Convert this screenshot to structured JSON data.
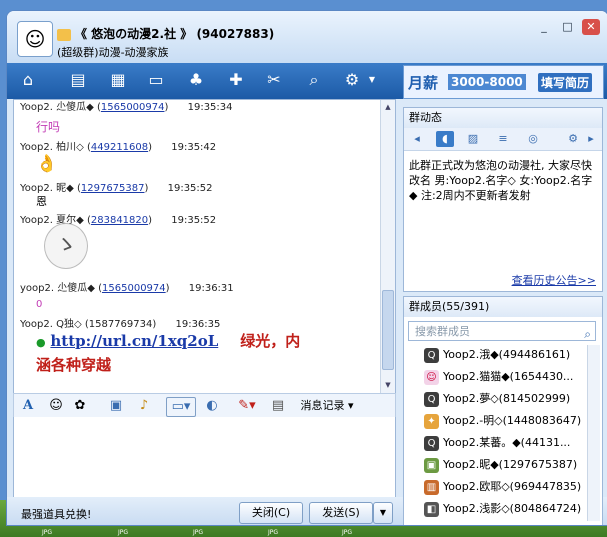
{
  "window": {
    "title": "《 悠泡の动漫2.社 》 (94027883)",
    "subtitle": "(超级群)动漫-动漫家族",
    "controls": [
      "_",
      "□",
      "✕"
    ]
  },
  "ad": {
    "brand": "月薪",
    "salary": "3000-8000",
    "cta": "填写简历"
  },
  "messages": [
    {
      "sender": "Yoop2. 尐傻瓜◆",
      "id": "1565000974",
      "time": "19:35:34",
      "body": "行吗"
    },
    {
      "sender": "Yoop2. 柏川◇",
      "id": "449211608",
      "time": "19:35:42",
      "body": ""
    },
    {
      "sender": "Yoop2. 昵◆",
      "id": "1297675387",
      "time": "19:35:52",
      "body": "恩"
    },
    {
      "sender": "Yoop2. 夏尔◆",
      "id": "283841820",
      "time": "19:35:52",
      "body": ""
    },
    {
      "sender": "yoop2. 尐傻瓜◆",
      "id": "1565000974",
      "time": "19:36:31",
      "body": "0"
    },
    {
      "sender": "Yoop2. Q独◇",
      "id": "1587769734",
      "time": "19:36:35",
      "body": ""
    }
  ],
  "link_message": {
    "url": "http://url.cn/1xq2oL",
    "line1_red": "绿光，内",
    "line2_red": "涵各种穿越"
  },
  "format_bar": {
    "history_label": "消息记录"
  },
  "bottom": {
    "promo": "最强道具兑换!",
    "close_label": "关闭(C)",
    "send_label": "发送(S)",
    "send_more": "▼"
  },
  "group_feed": {
    "title": "群动态",
    "notice": "此群正式改为悠泡の动漫社, 大家尽快改名 男:Yoop2.名字◇ 女:Yoop2.名字◆ 注:2周内不更新者发射",
    "history_link": "查看历史公告>>"
  },
  "members": {
    "title": "群成员(55/391)",
    "search_placeholder": "搜索群成员",
    "list": [
      "Yoop2.涐◆(494486161)",
      "Yoop2.猫猫◆(1654430...",
      "Yoop2.夢◇(814502999)",
      "Yoop2.-明◇(1448083647)",
      "Yoop2.某蕃。◆(44131...",
      "Yoop2.昵◆(1297675387)",
      "Yoop2.欧耶◇(969447835)",
      "Yoop2.浅影◇(804864724)"
    ]
  },
  "desktop_icons": [
    "JPG",
    "JPG",
    "JPG",
    "JPG",
    "JPG"
  ]
}
